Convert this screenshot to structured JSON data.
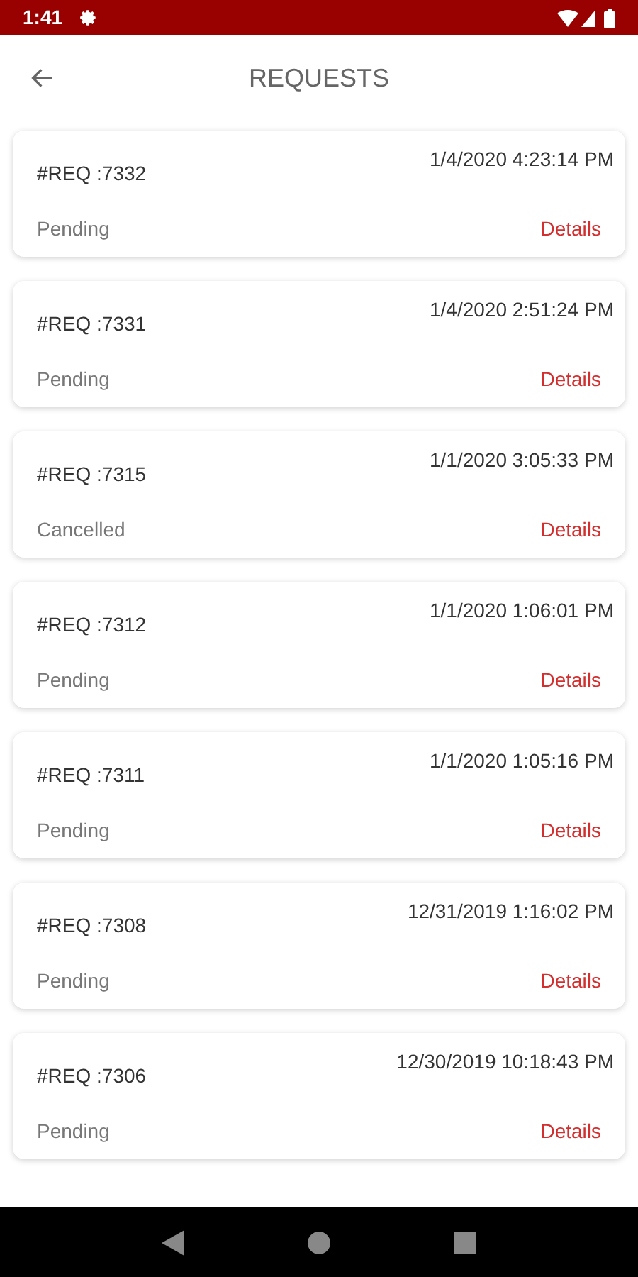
{
  "status_bar": {
    "time": "1:41"
  },
  "header": {
    "title": "REQUESTS"
  },
  "requests": [
    {
      "id": "#REQ :7332",
      "date": "1/4/2020 4:23:14 PM",
      "status": "Pending",
      "action": "Details"
    },
    {
      "id": "#REQ :7331",
      "date": "1/4/2020 2:51:24 PM",
      "status": "Pending",
      "action": "Details"
    },
    {
      "id": "#REQ :7315",
      "date": "1/1/2020 3:05:33 PM",
      "status": "Cancelled",
      "action": "Details"
    },
    {
      "id": "#REQ :7312",
      "date": "1/1/2020 1:06:01 PM",
      "status": "Pending",
      "action": "Details"
    },
    {
      "id": "#REQ :7311",
      "date": "1/1/2020 1:05:16 PM",
      "status": "Pending",
      "action": "Details"
    },
    {
      "id": "#REQ :7308",
      "date": "12/31/2019 1:16:02 PM",
      "status": "Pending",
      "action": "Details"
    },
    {
      "id": "#REQ :7306",
      "date": "12/30/2019 10:18:43 PM",
      "status": "Pending",
      "action": "Details"
    }
  ]
}
